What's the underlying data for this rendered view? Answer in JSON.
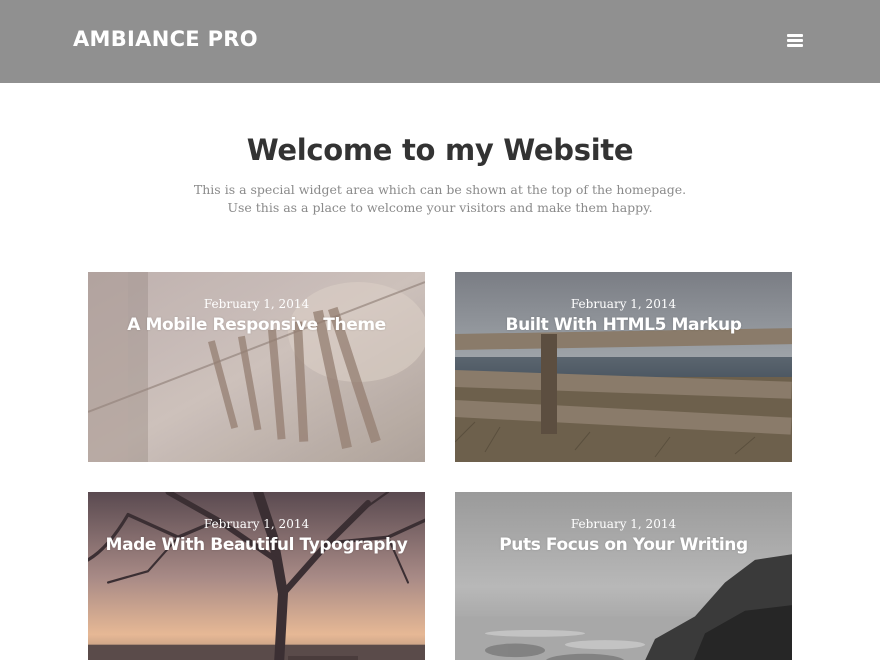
{
  "header": {
    "site_title": "AMBIANCE PRO",
    "menu_icon": "hamburger-menu-icon",
    "background": "#909090"
  },
  "welcome": {
    "title": "Welcome to my Website",
    "line1": "This is a special widget area which can be shown at the top of the homepage.",
    "line2": "Use this as a place to welcome your visitors and make them happy."
  },
  "posts": [
    {
      "date": "February 1, 2014",
      "title": "A Mobile Responsive Theme",
      "image": "clothespins-photo"
    },
    {
      "date": "February 1, 2014",
      "title": "Built With HTML5 Markup",
      "image": "wooden-fence-photo"
    },
    {
      "date": "February 1, 2014",
      "title": "Made With Beautiful Typography",
      "image": "bare-tree-sunset-photo"
    },
    {
      "date": "February 1, 2014",
      "title": "Puts Focus on Your Writing",
      "image": "rocky-coast-photo"
    }
  ]
}
